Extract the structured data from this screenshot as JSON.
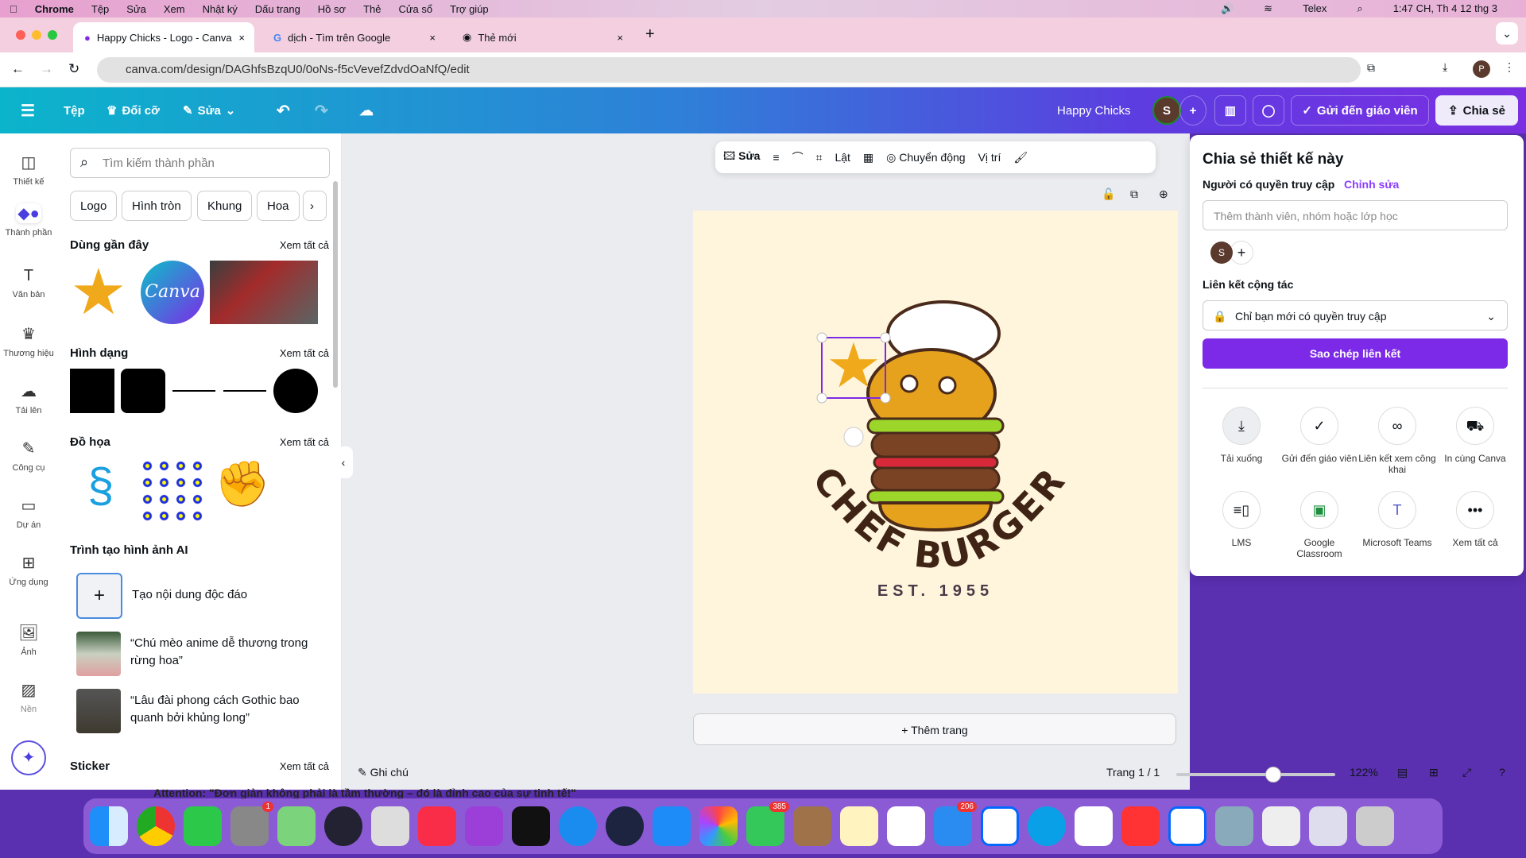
{
  "menubar": {
    "app": "Chrome",
    "items": [
      "Tệp",
      "Sửa",
      "Xem",
      "Nhật ký",
      "Dấu trang",
      "Hồ sơ",
      "Thẻ",
      "Cửa sổ",
      "Trợ giúp"
    ],
    "input_method": "Telex",
    "clock": "1:47 CH, Th 4 12 thg 3"
  },
  "browser": {
    "tabs": [
      {
        "title": "Happy Chicks - Logo - Canva"
      },
      {
        "title": "dịch - Tìm trên Google"
      },
      {
        "title": "Thẻ mới"
      }
    ],
    "url": "canva.com/design/DAGhfsBzqU0/0oNs-f5cVevefZdvdOaNfQ/edit",
    "profile": "P"
  },
  "header": {
    "file": "Tệp",
    "resize": "Đổi cỡ",
    "edit": "Sửa",
    "title": "Happy Chicks",
    "avatar": "S",
    "send_teacher": "Gửi đến giáo viên",
    "share": "Chia sẻ"
  },
  "rail": [
    {
      "label": "Thiết kế",
      "icon": "layout-icon"
    },
    {
      "label": "Thành phần",
      "icon": "elements-icon"
    },
    {
      "label": "Văn bản",
      "icon": "text-icon"
    },
    {
      "label": "Thương hiệu",
      "icon": "brand-icon"
    },
    {
      "label": "Tải lên",
      "icon": "upload-icon"
    },
    {
      "label": "Công cụ",
      "icon": "draw-icon"
    },
    {
      "label": "Dự án",
      "icon": "folder-icon"
    },
    {
      "label": "Ứng dụng",
      "icon": "apps-icon"
    },
    {
      "label": "Ảnh",
      "icon": "photo-icon"
    },
    {
      "label": "Nền",
      "icon": "background-icon"
    }
  ],
  "panel": {
    "search_placeholder": "Tìm kiếm thành phần",
    "chips": [
      "Logo",
      "Hình tròn",
      "Khung",
      "Hoa"
    ],
    "see_all": "Xem tất cả",
    "recent": "Dùng gần đây",
    "canva_logo": "Canva",
    "shapes": "Hình dạng",
    "graphics": "Đồ họa",
    "ai": "Trình tạo hình ảnh AI",
    "ai_create": "Tạo nội dung độc đáo",
    "ai_prompts": [
      "“Chú mèo anime dễ thương trong rừng hoa”",
      "“Lâu đài phong cách Gothic bao quanh bởi khủng long”"
    ],
    "sticker": "Sticker"
  },
  "toolbar": {
    "edit": "Sửa",
    "flip": "Lật",
    "animate": "Chuyển động",
    "position": "Vị trí"
  },
  "design": {
    "title": "CHEF BURGER",
    "subtitle": "EST. 1955"
  },
  "add_page": "+ Thêm trang",
  "footer": {
    "notes": "Ghi chú",
    "page": "Trang 1 / 1",
    "zoom": "122%",
    "zoom_percent": 122,
    "behind_text": "Attention: \"Đơn giản không phải là tầm thường – đó là đỉnh cao của sự tinh tế!\""
  },
  "share": {
    "title": "Chia sẻ thiết kế này",
    "access_label": "Người có quyền truy cập",
    "edit_link": "Chỉnh sửa",
    "invite_placeholder": "Thêm thành viên, nhóm hoặc lớp học",
    "avatar": "S",
    "collab_label": "Liên kết cộng tác",
    "access_value": "Chỉ bạn mới có quyền truy cập",
    "copy_link": "Sao chép liên kết",
    "actions": [
      {
        "label": "Tải xuống",
        "icon": "download-icon"
      },
      {
        "label": "Gửi đến giáo viên",
        "icon": "check-circle-icon"
      },
      {
        "label": "Liên kết xem công khai",
        "icon": "link-icon"
      },
      {
        "label": "In cùng Canva",
        "icon": "truck-icon"
      },
      {
        "label": "LMS",
        "icon": "lms-icon"
      },
      {
        "label": "Google Classroom",
        "icon": "google-classroom-icon"
      },
      {
        "label": "Microsoft Teams",
        "icon": "teams-icon"
      },
      {
        "label": "Xem tất cả",
        "icon": "more-icon"
      }
    ],
    "accent": "#7d2ae8"
  },
  "dock": {
    "badges": {
      "settings": "1",
      "messages": "385",
      "mail": "206"
    }
  }
}
